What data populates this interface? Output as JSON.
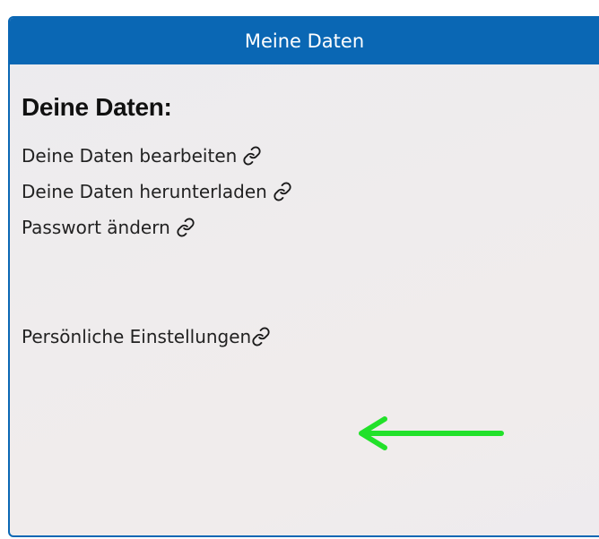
{
  "header": {
    "title": "Meine Daten"
  },
  "section": {
    "title": "Deine Daten:"
  },
  "links": [
    {
      "label": "Deine Daten bearbeiten",
      "icon": "link-icon"
    },
    {
      "label": "Deine Daten herunterladen",
      "icon": "link-icon"
    },
    {
      "label": "Passwort ändern",
      "icon": "link-icon"
    },
    {
      "label": "Persönliche Einstellungen",
      "icon": "link-icon"
    }
  ],
  "annotation": {
    "icon": "green-arrow-icon",
    "color": "#22e12a"
  },
  "colors": {
    "accent": "#0a67b4"
  }
}
